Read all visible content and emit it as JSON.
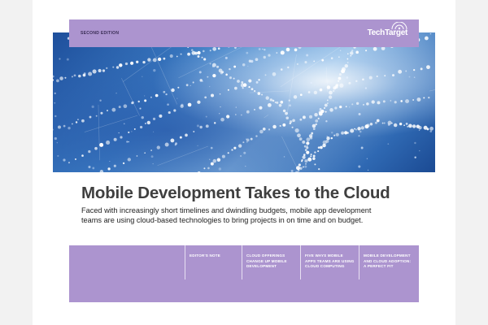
{
  "header": {
    "edition": "SECOND EDITION",
    "brand": "TechTarget"
  },
  "colors": {
    "accent_purple": "#ac94cf",
    "title_gray": "#3f3f3f",
    "hero_blue": "#2f69b3"
  },
  "hero": {
    "image": "blue abstract network of glowing dots"
  },
  "title": "Mobile Development Takes to the Cloud",
  "subtitle": "Faced with increasingly short timelines and dwindling budgets, mobile app development teams are using cloud-based technologies to bring projects in on time and on budget.",
  "nav": {
    "items": [
      {
        "lines": [
          "EDITOR'S NOTE"
        ]
      },
      {
        "lines": [
          "CLOUD OFFERINGS",
          "CHANGE UP MOBILE",
          "DEVELOPMENT"
        ]
      },
      {
        "lines": [
          "FIVE WAYS MOBILE",
          "APPS TEAMS ARE USING",
          "CLOUD COMPUTING"
        ]
      },
      {
        "lines": [
          "MOBILE DEVELOPMENT",
          "AND CLOUD ADOPTION:",
          "A PERFECT FIT"
        ]
      }
    ]
  }
}
